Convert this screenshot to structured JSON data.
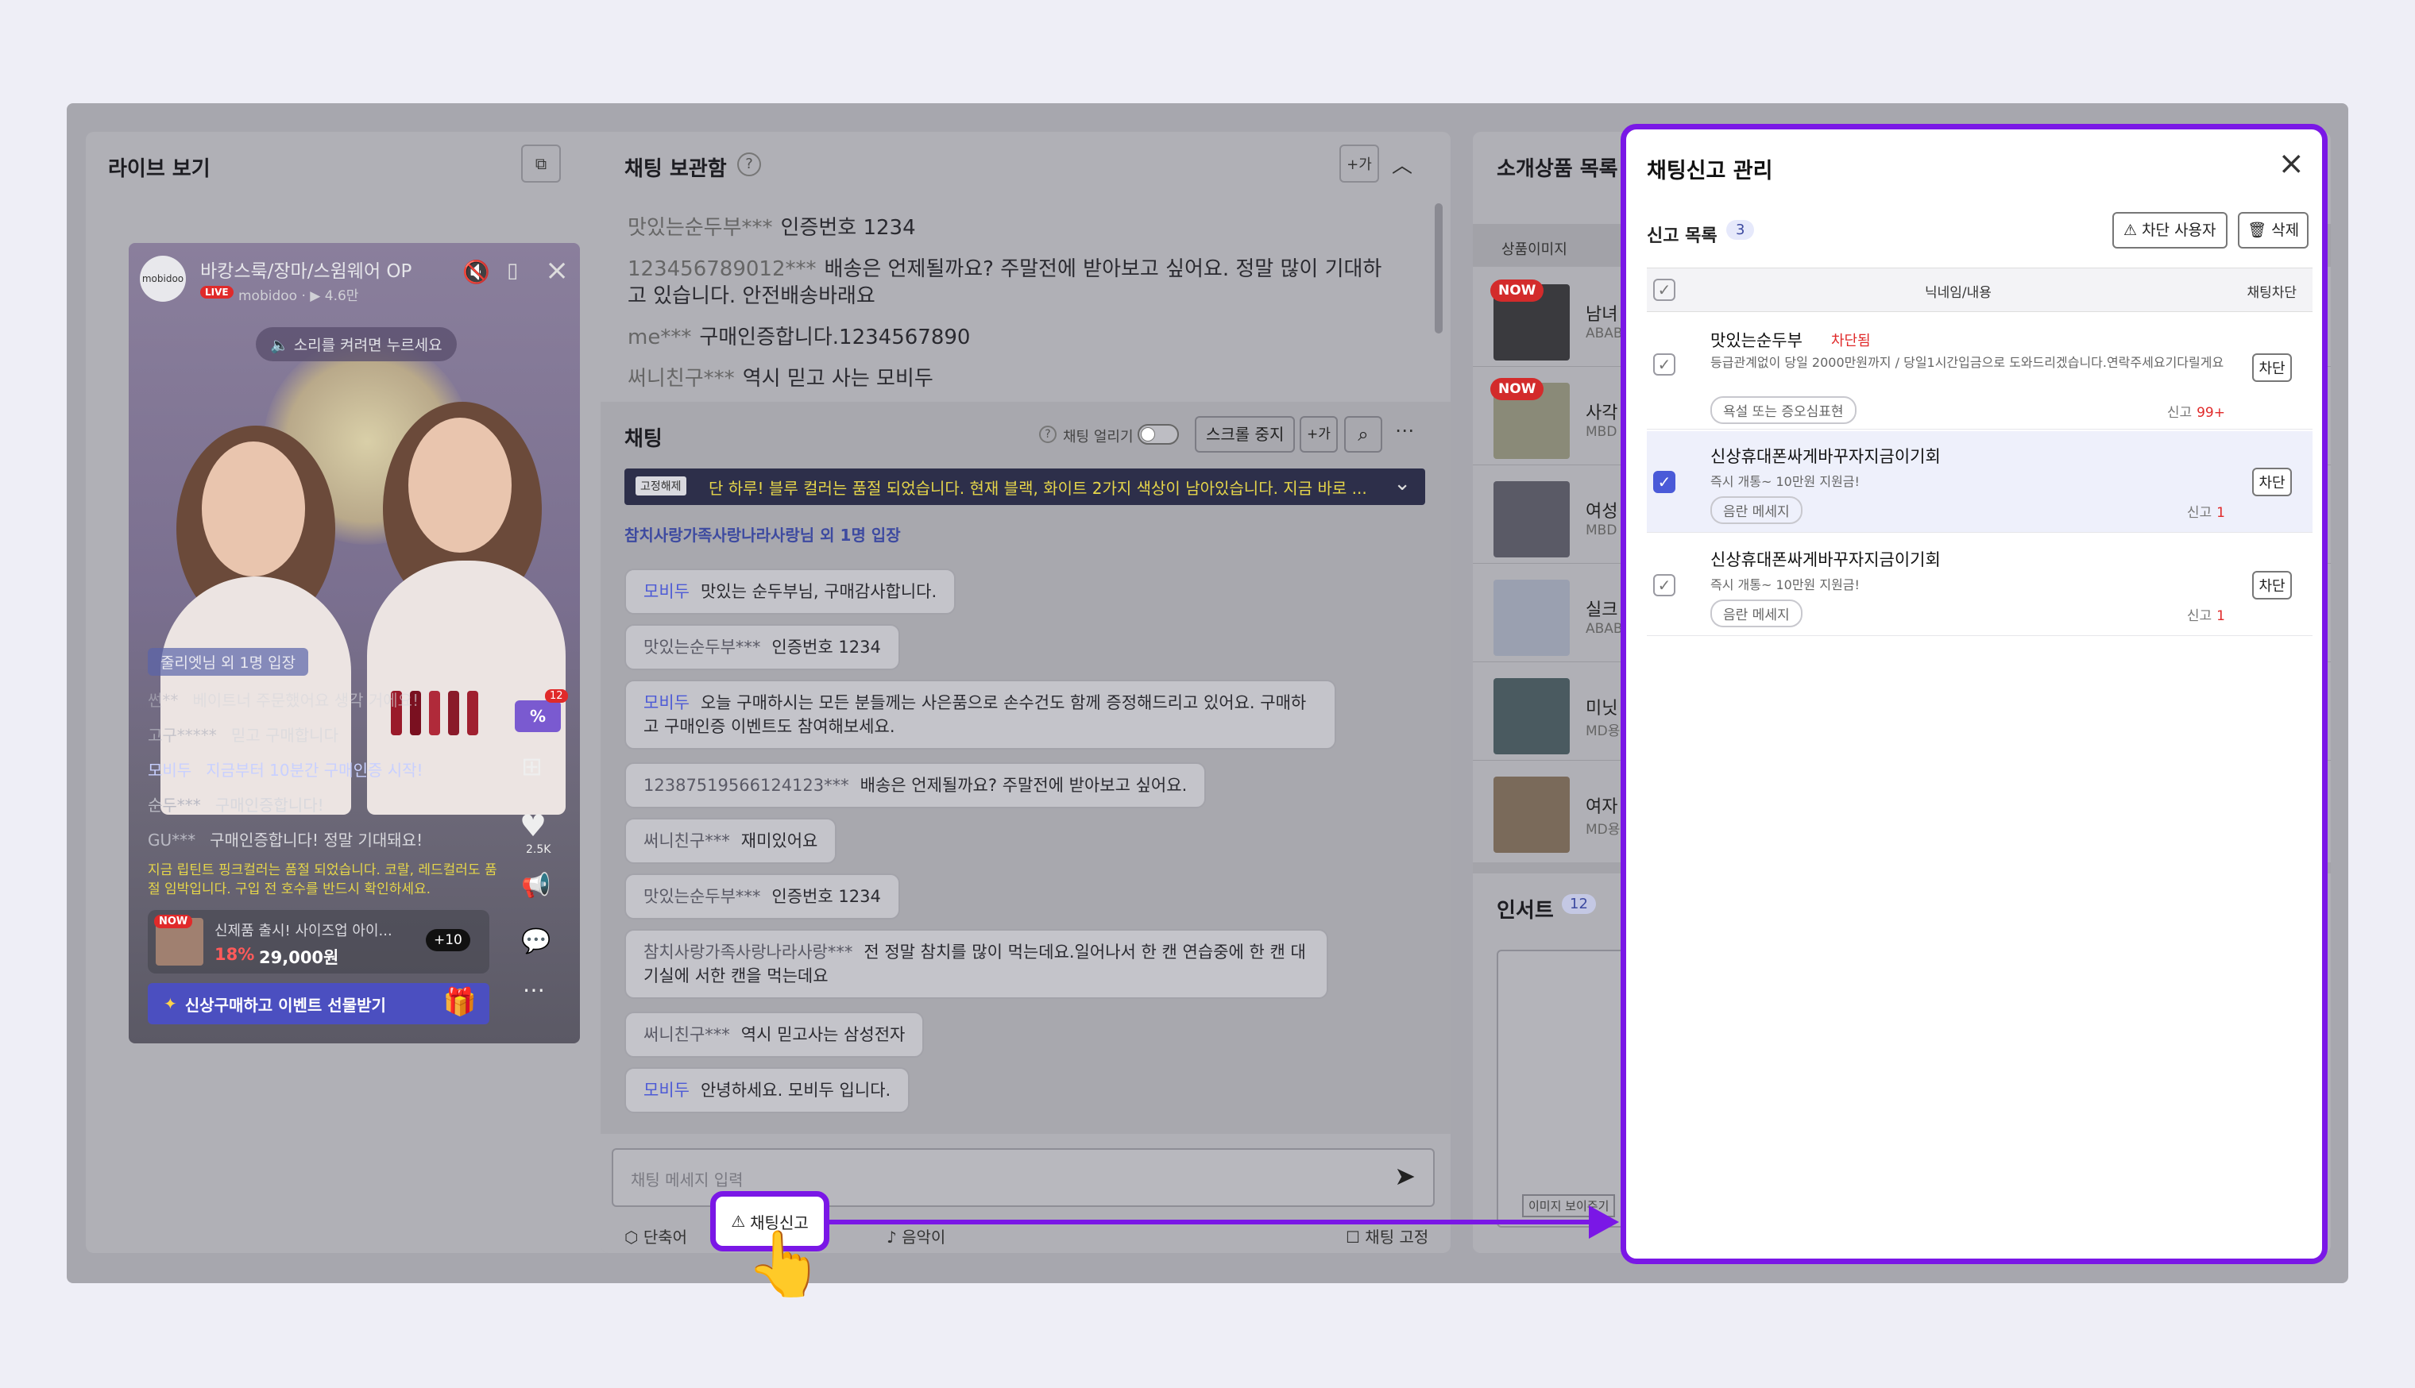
{
  "live": {
    "title": "라이브 보기",
    "channel": "바캉스룩/장마/스윔웨어 OP",
    "live_badge": "LIVE",
    "channel_sub": "mobidoo · ▶ 4.6만",
    "sound_hint": "소리를 켜려면 누르세요",
    "join_notice": "줄리엣님 외 1명 입장",
    "messages": [
      {
        "nick": "썬**",
        "text": "베이트너 주문했어요 생각 거에요!"
      },
      {
        "nick": "고구*****",
        "text": "믿고 구매합니다"
      },
      {
        "nick": "모비두",
        "text": "지금부터 10분간 구매인증 시작!"
      },
      {
        "nick": "순두***",
        "text": "구매인증합니다!"
      },
      {
        "nick": "GU***",
        "text": "구매인증합니다! 정말 기대돼요!"
      }
    ],
    "notice": "지금 립틴트 핑크컬러는 품절 되었습니다. 코랄, 레드컬러도 품절 임박입니다. 구입 전 호수를 반드시 확인하세요.",
    "product": {
      "badge": "NOW",
      "name": "신제품 출시! 사이즈업 아이...",
      "discount": "18%",
      "price": "29,000원",
      "more": "+10"
    },
    "coupon_badge": "12",
    "like_count": "2.5K",
    "event_banner": "신상구매하고 이벤트 선물받기"
  },
  "archive": {
    "title": "채팅 보관함",
    "plus_label": "+가",
    "messages": [
      {
        "nick": "맛있는순두부***",
        "text": "인증번호 1234"
      },
      {
        "nick": "123456789012***",
        "text": "배송은 언제될까요? 주말전에 받아보고 싶어요. 정말 많이 기대하고 있습니다. 안전배송바래요"
      },
      {
        "nick": "me***",
        "text": "구매인증합니다.1234567890"
      },
      {
        "nick": "써니친구***",
        "text": "역시 믿고 사는 모비두"
      }
    ]
  },
  "chat": {
    "title": "채팅",
    "toggle_label": "채팅 얼리기",
    "stop_scroll": "스크롤 중지",
    "plus_label": "+가",
    "pinned_tag": "고정해제",
    "pinned": "단 하루! 블루 컬러는 품절 되었습니다. 현재 블랙, 화이트 2가지 색상이 남아있습니다. 지금 바로 ...",
    "join": "참치사랑가족사랑나라사랑님 외 1명 입장",
    "messages": [
      {
        "nick": "모비두",
        "text": "맛있는 순두부님, 구매감사합니다.",
        "brand": true
      },
      {
        "nick": "맛있는순두부***",
        "text": "인증번호 1234"
      },
      {
        "nick": "모비두",
        "text": "오늘 구매하시는 모든 분들께는 사은품으로 손수건도 함께 증정해드리고 있어요. 구매하고 구매인증 이벤트도 참여해보세요.",
        "brand": true
      },
      {
        "nick": "12387519566124123***",
        "text": "배송은 언제될까요? 주말전에 받아보고 싶어요."
      },
      {
        "nick": "써니친구***",
        "text": "재미있어요"
      },
      {
        "nick": "맛있는순두부***",
        "text": "인증번호 1234"
      },
      {
        "nick": "참치사랑가족사랑나라사랑***",
        "text": "전 정말 참치를 많이 먹는데요.일어나서 한 캔 연습중에 한 캔 대기실에 서한 캔을 먹는데요"
      },
      {
        "nick": "써니친구***",
        "text": "역시 믿고사는 삼성전자"
      },
      {
        "nick": "모비두",
        "text": "안녕하세요. 모비두 입니다.",
        "brand": true
      }
    ],
    "input_placeholder": "채팅 메세지 입력",
    "shortcut": "단축어",
    "report": "채팅신고",
    "sound": "음악이",
    "fix": "채팅 고정"
  },
  "products": {
    "title": "소개상품 목록",
    "col_image": "상품이미지",
    "items": [
      {
        "badge": "NOW",
        "name": "남녀",
        "sub": "ABAB"
      },
      {
        "badge": "NOW",
        "name": "사각",
        "sub": "MBD"
      },
      {
        "badge": "",
        "name": "여성",
        "sub": "MBD"
      },
      {
        "badge": "",
        "name": "실크",
        "sub": "ABAB"
      },
      {
        "badge": "",
        "name": "미닛",
        "sub": "MD용"
      },
      {
        "badge": "",
        "name": "여자",
        "sub": "MD용"
      }
    ],
    "insert_title": "인서트",
    "insert_count": "12",
    "image_hint": "이미지 보이주기"
  },
  "report": {
    "title": "채팅신고 관리",
    "list_label": "신고 목록",
    "count": "3",
    "block_user": "차단 사용자",
    "delete": "삭제",
    "col_name": "닉네임/내용",
    "col_block": "채팅차단",
    "rows": [
      {
        "name": "맛있는순두부",
        "status": "차단됨",
        "content": "등급관계없이 당일 2000만원까지 / 당일1시간입금으로 도와드리겠습니다.연락주세요기다릴게요",
        "tag": "욕설 또는 증오심표현",
        "count_label": "신고",
        "count": "99+",
        "block": "차단",
        "checked": false
      },
      {
        "name": "신상휴대폰싸게바꾸자지금이기회",
        "status": "",
        "content": "즉시 개통~ 10만원 지원금!",
        "tag": "음란 메세지",
        "count_label": "신고",
        "count": "1",
        "block": "차단",
        "checked": true
      },
      {
        "name": "신상휴대폰싸게바꾸자지금이기회",
        "status": "",
        "content": "즉시 개통~ 10만원 지원금!",
        "tag": "음란 메세지",
        "count_label": "신고",
        "count": "1",
        "block": "차단",
        "checked": false
      }
    ]
  },
  "colors": {
    "accent": "#7a17e6",
    "brand_blue": "#4d5ad6",
    "danger": "#e02a2a"
  }
}
